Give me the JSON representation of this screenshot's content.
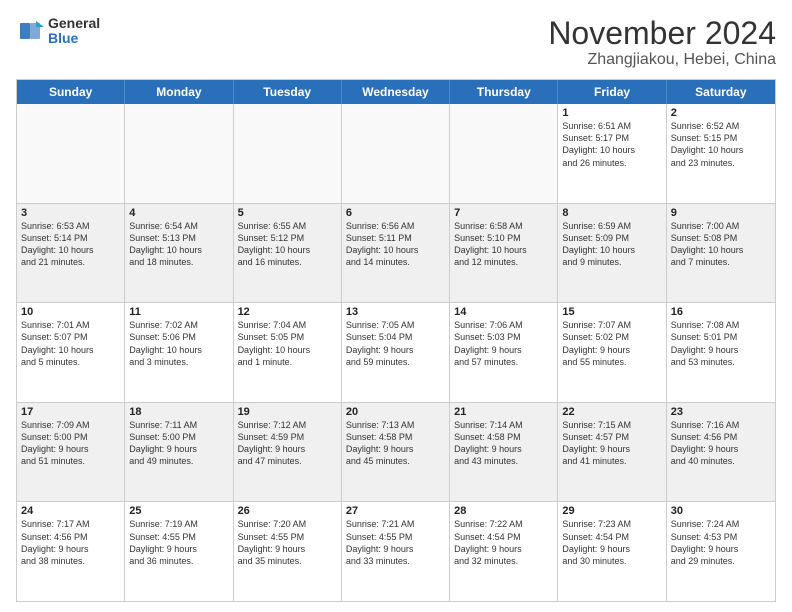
{
  "header": {
    "logo_general": "General",
    "logo_blue": "Blue",
    "month_title": "November 2024",
    "location": "Zhangjiakou, Hebei, China"
  },
  "weekdays": [
    "Sunday",
    "Monday",
    "Tuesday",
    "Wednesday",
    "Thursday",
    "Friday",
    "Saturday"
  ],
  "rows": [
    [
      {
        "day": "",
        "text": ""
      },
      {
        "day": "",
        "text": ""
      },
      {
        "day": "",
        "text": ""
      },
      {
        "day": "",
        "text": ""
      },
      {
        "day": "",
        "text": ""
      },
      {
        "day": "1",
        "text": "Sunrise: 6:51 AM\nSunset: 5:17 PM\nDaylight: 10 hours\nand 26 minutes."
      },
      {
        "day": "2",
        "text": "Sunrise: 6:52 AM\nSunset: 5:15 PM\nDaylight: 10 hours\nand 23 minutes."
      }
    ],
    [
      {
        "day": "3",
        "text": "Sunrise: 6:53 AM\nSunset: 5:14 PM\nDaylight: 10 hours\nand 21 minutes."
      },
      {
        "day": "4",
        "text": "Sunrise: 6:54 AM\nSunset: 5:13 PM\nDaylight: 10 hours\nand 18 minutes."
      },
      {
        "day": "5",
        "text": "Sunrise: 6:55 AM\nSunset: 5:12 PM\nDaylight: 10 hours\nand 16 minutes."
      },
      {
        "day": "6",
        "text": "Sunrise: 6:56 AM\nSunset: 5:11 PM\nDaylight: 10 hours\nand 14 minutes."
      },
      {
        "day": "7",
        "text": "Sunrise: 6:58 AM\nSunset: 5:10 PM\nDaylight: 10 hours\nand 12 minutes."
      },
      {
        "day": "8",
        "text": "Sunrise: 6:59 AM\nSunset: 5:09 PM\nDaylight: 10 hours\nand 9 minutes."
      },
      {
        "day": "9",
        "text": "Sunrise: 7:00 AM\nSunset: 5:08 PM\nDaylight: 10 hours\nand 7 minutes."
      }
    ],
    [
      {
        "day": "10",
        "text": "Sunrise: 7:01 AM\nSunset: 5:07 PM\nDaylight: 10 hours\nand 5 minutes."
      },
      {
        "day": "11",
        "text": "Sunrise: 7:02 AM\nSunset: 5:06 PM\nDaylight: 10 hours\nand 3 minutes."
      },
      {
        "day": "12",
        "text": "Sunrise: 7:04 AM\nSunset: 5:05 PM\nDaylight: 10 hours\nand 1 minute."
      },
      {
        "day": "13",
        "text": "Sunrise: 7:05 AM\nSunset: 5:04 PM\nDaylight: 9 hours\nand 59 minutes."
      },
      {
        "day": "14",
        "text": "Sunrise: 7:06 AM\nSunset: 5:03 PM\nDaylight: 9 hours\nand 57 minutes."
      },
      {
        "day": "15",
        "text": "Sunrise: 7:07 AM\nSunset: 5:02 PM\nDaylight: 9 hours\nand 55 minutes."
      },
      {
        "day": "16",
        "text": "Sunrise: 7:08 AM\nSunset: 5:01 PM\nDaylight: 9 hours\nand 53 minutes."
      }
    ],
    [
      {
        "day": "17",
        "text": "Sunrise: 7:09 AM\nSunset: 5:00 PM\nDaylight: 9 hours\nand 51 minutes."
      },
      {
        "day": "18",
        "text": "Sunrise: 7:11 AM\nSunset: 5:00 PM\nDaylight: 9 hours\nand 49 minutes."
      },
      {
        "day": "19",
        "text": "Sunrise: 7:12 AM\nSunset: 4:59 PM\nDaylight: 9 hours\nand 47 minutes."
      },
      {
        "day": "20",
        "text": "Sunrise: 7:13 AM\nSunset: 4:58 PM\nDaylight: 9 hours\nand 45 minutes."
      },
      {
        "day": "21",
        "text": "Sunrise: 7:14 AM\nSunset: 4:58 PM\nDaylight: 9 hours\nand 43 minutes."
      },
      {
        "day": "22",
        "text": "Sunrise: 7:15 AM\nSunset: 4:57 PM\nDaylight: 9 hours\nand 41 minutes."
      },
      {
        "day": "23",
        "text": "Sunrise: 7:16 AM\nSunset: 4:56 PM\nDaylight: 9 hours\nand 40 minutes."
      }
    ],
    [
      {
        "day": "24",
        "text": "Sunrise: 7:17 AM\nSunset: 4:56 PM\nDaylight: 9 hours\nand 38 minutes."
      },
      {
        "day": "25",
        "text": "Sunrise: 7:19 AM\nSunset: 4:55 PM\nDaylight: 9 hours\nand 36 minutes."
      },
      {
        "day": "26",
        "text": "Sunrise: 7:20 AM\nSunset: 4:55 PM\nDaylight: 9 hours\nand 35 minutes."
      },
      {
        "day": "27",
        "text": "Sunrise: 7:21 AM\nSunset: 4:55 PM\nDaylight: 9 hours\nand 33 minutes."
      },
      {
        "day": "28",
        "text": "Sunrise: 7:22 AM\nSunset: 4:54 PM\nDaylight: 9 hours\nand 32 minutes."
      },
      {
        "day": "29",
        "text": "Sunrise: 7:23 AM\nSunset: 4:54 PM\nDaylight: 9 hours\nand 30 minutes."
      },
      {
        "day": "30",
        "text": "Sunrise: 7:24 AM\nSunset: 4:53 PM\nDaylight: 9 hours\nand 29 minutes."
      }
    ]
  ]
}
